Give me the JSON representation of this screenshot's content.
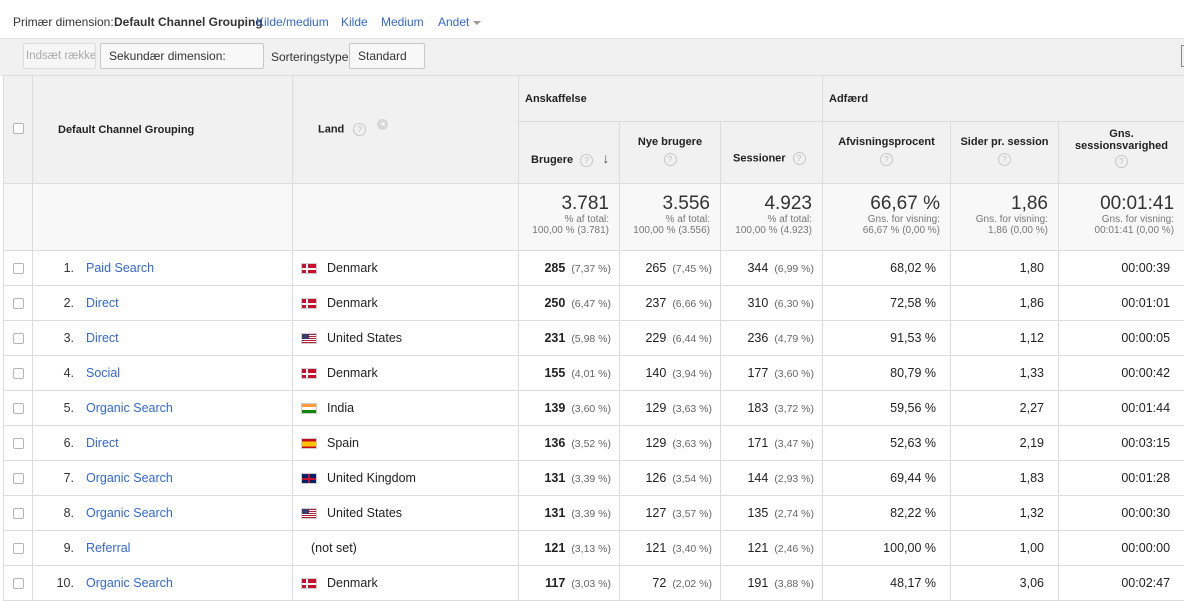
{
  "dimension_bar": {
    "primary_label": "Primær dimension:",
    "current": "Default Channel Grouping",
    "links": [
      "Kilde/medium",
      "Kilde",
      "Medium"
    ],
    "other": "Andet"
  },
  "toolbar": {
    "insert_rows": "Indsæt rækker",
    "secondary_dimension": "Sekundær dimension: Land",
    "sort_label": "Sorteringstype",
    "sort_value": "Standard"
  },
  "table": {
    "col_dimension": "Default Channel Grouping",
    "col_land": "Land",
    "group_acquisition": "Anskaffelse",
    "group_behavior": "Adfærd",
    "col_users": "Brugere",
    "col_new_users": "Nye brugere",
    "col_sessions": "Sessioner",
    "col_bounce": "Afvisningsprocent",
    "col_pages": "Sider pr. session",
    "col_duration_1": "Gns.",
    "col_duration_2": "sessionsvarighed",
    "help_glyph": "?",
    "remove_glyph": "×",
    "sort_arrow": "↓",
    "totals": {
      "users": "3.781",
      "users_sub1": "% af total:",
      "users_sub2": "100,00 % (3.781)",
      "new_users": "3.556",
      "new_users_sub1": "% af total:",
      "new_users_sub2": "100,00 % (3.556)",
      "sessions": "4.923",
      "sessions_sub1": "% af total:",
      "sessions_sub2": "100,00 % (4.923)",
      "bounce": "66,67 %",
      "bounce_sub1": "Gns. for visning:",
      "bounce_sub2": "66,67 % (0,00 %)",
      "pages": "1,86",
      "pages_sub1": "Gns. for visning:",
      "pages_sub2": "1,86 (0,00 %)",
      "duration": "00:01:41",
      "duration_sub1": "Gns. for visning:",
      "duration_sub2": "00:01:41 (0,00 %)"
    },
    "rows": [
      {
        "num": "1.",
        "channel": "Paid Search",
        "flag": "dk",
        "country": "Denmark",
        "users": "285",
        "users_pct": "(7,37 %)",
        "new_users": "265",
        "new_users_pct": "(7,45 %)",
        "sessions": "344",
        "sessions_pct": "(6,99 %)",
        "bounce": "68,02 %",
        "pages": "1,80",
        "duration": "00:00:39"
      },
      {
        "num": "2.",
        "channel": "Direct",
        "flag": "dk",
        "country": "Denmark",
        "users": "250",
        "users_pct": "(6,47 %)",
        "new_users": "237",
        "new_users_pct": "(6,66 %)",
        "sessions": "310",
        "sessions_pct": "(6,30 %)",
        "bounce": "72,58 %",
        "pages": "1,86",
        "duration": "00:01:01"
      },
      {
        "num": "3.",
        "channel": "Direct",
        "flag": "us",
        "country": "United States",
        "users": "231",
        "users_pct": "(5,98 %)",
        "new_users": "229",
        "new_users_pct": "(6,44 %)",
        "sessions": "236",
        "sessions_pct": "(4,79 %)",
        "bounce": "91,53 %",
        "pages": "1,12",
        "duration": "00:00:05"
      },
      {
        "num": "4.",
        "channel": "Social",
        "flag": "dk",
        "country": "Denmark",
        "users": "155",
        "users_pct": "(4,01 %)",
        "new_users": "140",
        "new_users_pct": "(3,94 %)",
        "sessions": "177",
        "sessions_pct": "(3,60 %)",
        "bounce": "80,79 %",
        "pages": "1,33",
        "duration": "00:00:42"
      },
      {
        "num": "5.",
        "channel": "Organic Search",
        "flag": "in",
        "country": "India",
        "users": "139",
        "users_pct": "(3,60 %)",
        "new_users": "129",
        "new_users_pct": "(3,63 %)",
        "sessions": "183",
        "sessions_pct": "(3,72 %)",
        "bounce": "59,56 %",
        "pages": "2,27",
        "duration": "00:01:44"
      },
      {
        "num": "6.",
        "channel": "Direct",
        "flag": "es",
        "country": "Spain",
        "users": "136",
        "users_pct": "(3,52 %)",
        "new_users": "129",
        "new_users_pct": "(3,63 %)",
        "sessions": "171",
        "sessions_pct": "(3,47 %)",
        "bounce": "52,63 %",
        "pages": "2,19",
        "duration": "00:03:15"
      },
      {
        "num": "7.",
        "channel": "Organic Search",
        "flag": "gb",
        "country": "United Kingdom",
        "users": "131",
        "users_pct": "(3,39 %)",
        "new_users": "126",
        "new_users_pct": "(3,54 %)",
        "sessions": "144",
        "sessions_pct": "(2,93 %)",
        "bounce": "69,44 %",
        "pages": "1,83",
        "duration": "00:01:28"
      },
      {
        "num": "8.",
        "channel": "Organic Search",
        "flag": "us",
        "country": "United States",
        "users": "131",
        "users_pct": "(3,39 %)",
        "new_users": "127",
        "new_users_pct": "(3,57 %)",
        "sessions": "135",
        "sessions_pct": "(2,74 %)",
        "bounce": "82,22 %",
        "pages": "1,32",
        "duration": "00:00:30"
      },
      {
        "num": "9.",
        "channel": "Referral",
        "flag": "",
        "country": "(not set)",
        "users": "121",
        "users_pct": "(3,13 %)",
        "new_users": "121",
        "new_users_pct": "(3,40 %)",
        "sessions": "121",
        "sessions_pct": "(2,46 %)",
        "bounce": "100,00 %",
        "pages": "1,00",
        "duration": "00:00:00"
      },
      {
        "num": "10.",
        "channel": "Organic Search",
        "flag": "dk",
        "country": "Denmark",
        "users": "117",
        "users_pct": "(3,03 %)",
        "new_users": "72",
        "new_users_pct": "(2,02 %)",
        "sessions": "191",
        "sessions_pct": "(3,88 %)",
        "bounce": "48,17 %",
        "pages": "3,06",
        "duration": "00:02:47"
      }
    ]
  }
}
